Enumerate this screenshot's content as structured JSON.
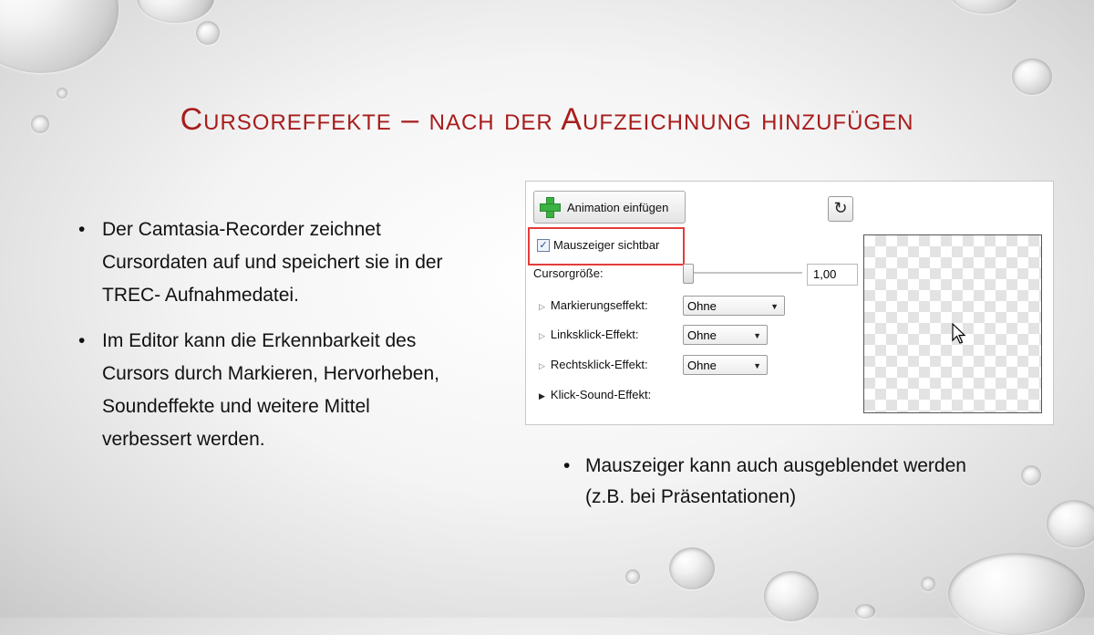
{
  "slide": {
    "title": "Cursoreffekte – nach der Aufzeichnung hinzufügen",
    "bullets_left": [
      "Der Camtasia-Recorder zeichnet Cursordaten auf und speichert sie in der TREC- Aufnahmedatei.",
      "Im Editor kann die Erkennbarkeit des Cursors durch Markieren, Hervorheben, Soundeffekte und weitere Mittel verbessert werden."
    ],
    "bullet_right": "Mauszeiger kann auch ausgeblendet werden (z.B. bei Präsentationen)"
  },
  "panel": {
    "animation_button": "Animation einfügen",
    "reset_icon": "reset-icon",
    "show_pointer_label": "Mauszeiger sichtbar",
    "show_pointer_checked": true,
    "cursor_size_label": "Cursorgröße:",
    "cursor_size_value": "1,00",
    "cursor_size_slider_fraction": 0.0,
    "rows": [
      {
        "label": "Markierungseffekt:",
        "value": "Ohne"
      },
      {
        "label": "Linksklick-Effekt:",
        "value": "Ohne"
      },
      {
        "label": "Rechtsklick-Effekt:",
        "value": "Ohne"
      },
      {
        "label": "Klick-Sound-Effekt:",
        "value": ""
      }
    ],
    "accent_color": "#a81c1c",
    "highlight_color": "#e53b3b"
  }
}
